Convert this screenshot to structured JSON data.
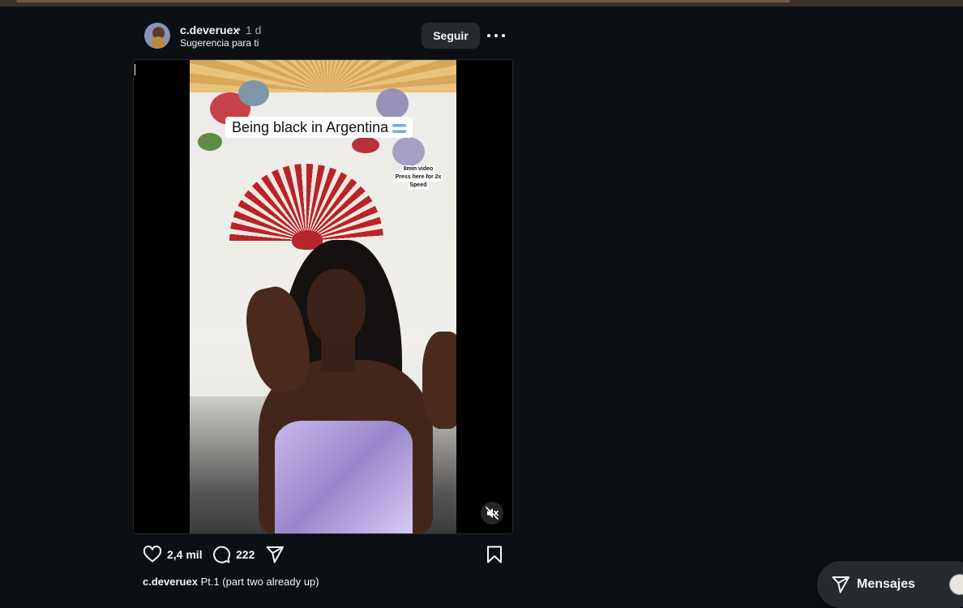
{
  "post": {
    "username": "c.deveruex",
    "separator": "•",
    "time": "1 d",
    "subtitle": "Sugerencia para ti",
    "follow_label": "Seguir",
    "more_icon": "more-horizontal-icon"
  },
  "video": {
    "overlay_title": "Being black in Argentina",
    "overlay_flag": "argentina-flag",
    "note_lines": [
      "8min video",
      "Press here for 2x",
      "Speed"
    ],
    "mute_icon": "muted-speaker-icon"
  },
  "actions": {
    "like_icon": "heart-icon",
    "like_count": "2,4 mil",
    "comment_icon": "comment-icon",
    "comment_count": "222",
    "share_icon": "send-icon",
    "save_icon": "bookmark-icon"
  },
  "caption": {
    "username": "c.deveruex",
    "text": "Pt.1 (part two already up)"
  },
  "messages": {
    "label": "Mensajes",
    "icon": "send-icon"
  }
}
